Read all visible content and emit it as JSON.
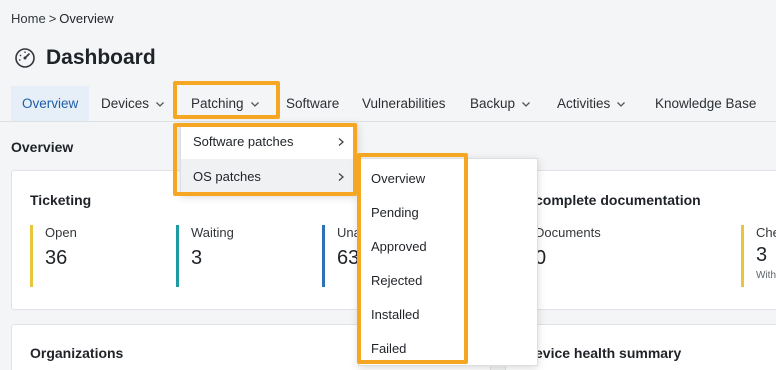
{
  "breadcrumb": {
    "home": "Home",
    "separator": ">",
    "current": "Overview"
  },
  "page": {
    "title": "Dashboard",
    "title_icon": "dashboard-gauge-icon"
  },
  "nav": {
    "tabs": [
      {
        "label": "Overview",
        "active": true
      },
      {
        "label": "Devices",
        "dropdown": true
      },
      {
        "label": "Patching",
        "dropdown": true
      },
      {
        "label": "Software"
      },
      {
        "label": "Vulnerabilities"
      },
      {
        "label": "Backup",
        "dropdown": true
      },
      {
        "label": "Activities",
        "dropdown": true
      },
      {
        "label": "Knowledge Base"
      }
    ]
  },
  "section": {
    "label": "Overview"
  },
  "ticketing": {
    "title": "Ticketing",
    "metrics": [
      {
        "label": "Open",
        "value": "36",
        "color": "#e8c53a"
      },
      {
        "label": "Waiting",
        "value": "3",
        "color": "#1e9aa3"
      },
      {
        "label": "Una",
        "value": "63",
        "color": "#2d6fb8"
      }
    ]
  },
  "documentation": {
    "title": "complete documentation",
    "metrics": [
      {
        "label": "Documents",
        "value": "0",
        "color": "#e8c53a"
      },
      {
        "label": "Che",
        "value": "3",
        "sub": "With",
        "color": "#e8c53a"
      }
    ]
  },
  "organizations": {
    "title": "Organizations"
  },
  "device_health": {
    "title": "evice health summary"
  },
  "patching_menu": {
    "items": [
      {
        "label": "Software patches"
      },
      {
        "label": "OS patches"
      }
    ]
  },
  "os_patches_menu": {
    "items": [
      "Overview",
      "Pending",
      "Approved",
      "Rejected",
      "Installed",
      "Failed"
    ]
  },
  "colors": {
    "highlight": "#f5a623",
    "active_tab_bg": "#e6eef7",
    "active_tab_text": "#1d5ea8"
  }
}
